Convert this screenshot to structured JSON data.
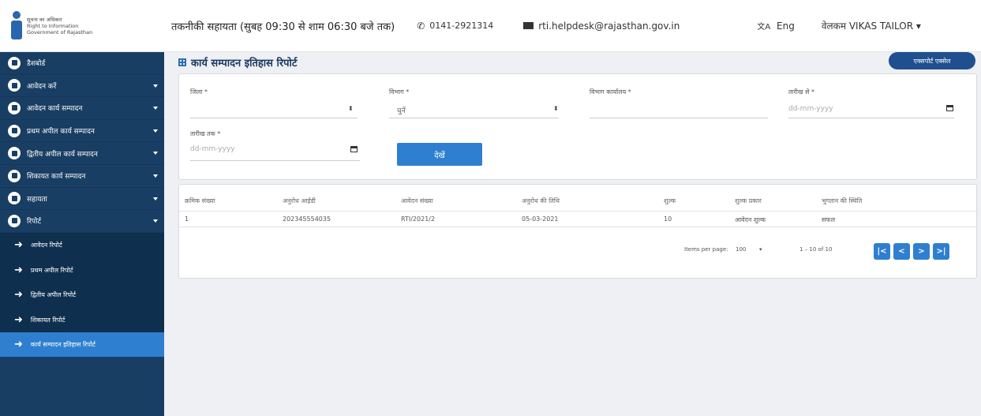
{
  "header": {
    "logo_lines": [
      "सूचना का अधिकार",
      "Right to Information",
      "Government of Rajasthan"
    ],
    "helpline": "तकनीकी सहायता (सुबह 09:30 से शाम 06:30 बजे तक)",
    "phone": "0141-2921314",
    "email": "rti.helpdesk@rajasthan.gov.in",
    "language": "Eng",
    "user": "वेलकम VIKAS TAILOR ▾"
  },
  "sidebar": {
    "items": [
      {
        "label": "डैशबोर्ड"
      },
      {
        "label": "आवेदन करें"
      },
      {
        "label": "आवेदन कार्य सम्पादन"
      },
      {
        "label": "प्रथम अपील कार्य सम्पादन"
      },
      {
        "label": "द्वितीय अपील कार्य सम्पादन"
      },
      {
        "label": "शिकायत कार्य सम्पादन"
      },
      {
        "label": "सहायता"
      },
      {
        "label": "रिपोर्ट"
      }
    ],
    "sub_items": [
      {
        "label": "आवेदन रिपोर्ट"
      },
      {
        "label": "प्रथम अपील रिपोर्ट"
      },
      {
        "label": "द्वितीय अपील रिपोर्ट"
      },
      {
        "label": "शिकायत रिपोर्ट"
      },
      {
        "label": "कार्य सम्पादन इतिहास रिपोर्ट"
      }
    ]
  },
  "page": {
    "title": "कार्य सम्पादन इतिहास रिपोर्ट",
    "print_button": "एक्सपोर्ट एक्सेल"
  },
  "filters": {
    "district_label": "जिला *",
    "department_label": "विभाग *",
    "department_value": "चुनें",
    "officer_label": "विभाग कार्यालय *",
    "date_from_label": "तारीख से *",
    "date_from_placeholder": "dd-mm-yyyy",
    "date_to_label": "तारीख तक *",
    "date_to_placeholder": "dd-mm-yyyy",
    "submit_label": "देखें"
  },
  "table": {
    "columns": [
      "क्रमिक संख्या",
      "अनुरोध आईडी",
      "आवेदन संख्या",
      "अनुरोध की तिथि",
      "शुल्क",
      "शुल्क प्रकार",
      "भुगतान की स्थिति"
    ],
    "rows": [
      [
        "1",
        "202345554035",
        "RTI/2021/2",
        "05-03-2021",
        "10",
        "आवेदन शुल्क",
        "सफल"
      ]
    ],
    "items_per_page_label": "Items per page:",
    "items_per_page_value": "100",
    "range": "1 – 10 of 10"
  }
}
